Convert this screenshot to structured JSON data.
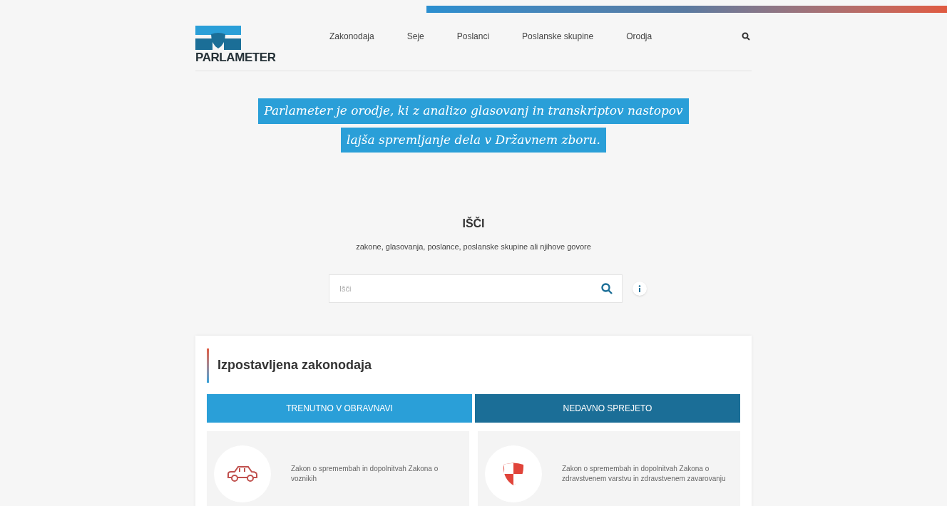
{
  "logo": {
    "text": "PARLAMETER"
  },
  "nav": {
    "items": [
      "Zakonodaja",
      "Seje",
      "Poslanci",
      "Poslanske skupine",
      "Orodja"
    ]
  },
  "tagline": [
    "Parlameter je orodje, ki z analizo glasovanj in transkriptov nastopov",
    "lajša spremljanje dela v Državnem zboru."
  ],
  "search": {
    "title": "IŠČI",
    "subtitle": "zakone, glasovanja, poslance, poslanske skupine ali njihove govore",
    "placeholder": "Išči"
  },
  "featured": {
    "title": "Izpostavljena zakonodaja",
    "columns": [
      {
        "header": "TRENUTNO V OBRAVNAVI",
        "color": "#2a9fd8",
        "item": {
          "kind": "car",
          "text": "Zakon o spremembah in dopolnitvah Zakona o voznikih"
        }
      },
      {
        "header": "NEDAVNO SPREJETO",
        "color": "#1b6e97",
        "item": {
          "kind": "shield",
          "text": "Zakon o spremembah in dopolnitvah Zakona o zdravstvenem varstvu in zdravstvenem zavarovanju"
        }
      }
    ]
  }
}
